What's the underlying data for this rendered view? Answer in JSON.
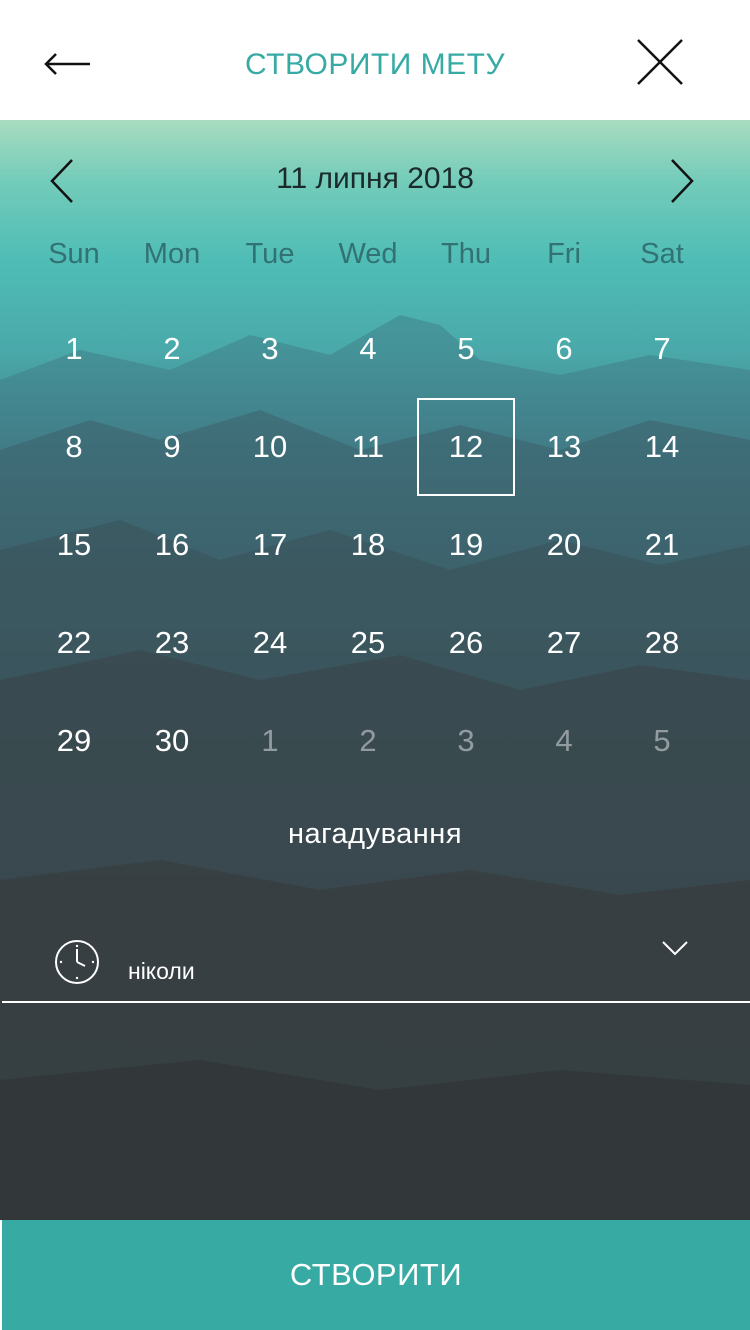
{
  "header": {
    "title": "СТВОРИТИ МЕТУ",
    "back_icon": "arrow-left-icon",
    "close_icon": "close-icon"
  },
  "calendar": {
    "month_label": "11 липня 2018",
    "prev_icon": "chevron-left-icon",
    "next_icon": "chevron-right-icon",
    "weekdays": [
      "Sun",
      "Mon",
      "Tue",
      "Wed",
      "Thu",
      "Fri",
      "Sat"
    ],
    "weeks": [
      [
        "1",
        "2",
        "3",
        "4",
        "5",
        "6",
        "7"
      ],
      [
        "8",
        "9",
        "10",
        "11",
        "12",
        "13",
        "14"
      ],
      [
        "15",
        "16",
        "17",
        "18",
        "19",
        "20",
        "21"
      ],
      [
        "22",
        "23",
        "24",
        "25",
        "26",
        "27",
        "28"
      ],
      [
        "29",
        "30",
        "1",
        "2",
        "3",
        "4",
        "5"
      ]
    ],
    "selected_day": "12",
    "next_month_days_muted": [
      "1",
      "2",
      "3",
      "4",
      "5"
    ]
  },
  "reminder": {
    "label": "нагадування",
    "value": "ніколи",
    "clock_icon": "clock-icon",
    "dropdown_icon": "chevron-down-icon"
  },
  "actions": {
    "create_label": "СТВОРИТИ"
  },
  "colors": {
    "accent": "#37aaa4",
    "text_light": "#ffffff"
  }
}
